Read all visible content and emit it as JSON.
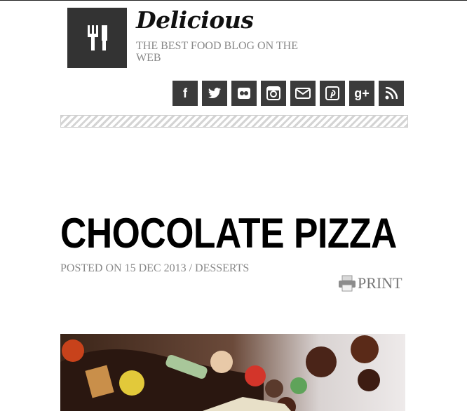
{
  "site": {
    "title": "Delicious",
    "tagline": "THE BEST FOOD BLOG ON THE WEB",
    "logo_icon": "fork-knife-icon"
  },
  "social": [
    {
      "name": "facebook-icon",
      "glyph": "f"
    },
    {
      "name": "twitter-icon",
      "glyph": ""
    },
    {
      "name": "flickr-icon",
      "glyph": ""
    },
    {
      "name": "instagram-icon",
      "glyph": ""
    },
    {
      "name": "email-icon",
      "glyph": ""
    },
    {
      "name": "pinterest-icon",
      "glyph": ""
    },
    {
      "name": "google-plus-icon",
      "glyph": "g+"
    },
    {
      "name": "rss-icon",
      "glyph": ""
    }
  ],
  "post": {
    "title": "CHOCOLATE PIZZA",
    "posted_on": "POSTED ON 15 DEC 2013",
    "separator": "/",
    "category": "DESSERTS",
    "print_label": "PRINT"
  },
  "colors": {
    "logo_bg": "#333333",
    "social_bg": "#3b3b3b",
    "meta_text": "#888888"
  }
}
